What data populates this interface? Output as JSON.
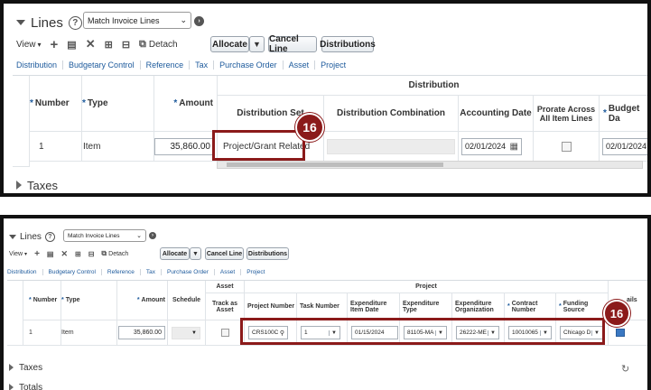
{
  "panel1": {
    "title": "Lines",
    "help": "?",
    "view_selector": "Match Invoice Lines",
    "toolbar": {
      "view": "View",
      "detach": "Detach",
      "allocate": "Allocate",
      "cancel_line": "Cancel Line",
      "distributions": "Distributions"
    },
    "links": [
      "Distribution",
      "Budgetary Control",
      "Reference",
      "Tax",
      "Purchase Order",
      "Asset",
      "Project"
    ],
    "table": {
      "group_header": "Distribution",
      "col_number": "Number",
      "col_type": "Type",
      "col_amount": "Amount",
      "col_distribution_set": "Distribution Set",
      "col_distribution_combination": "Distribution Combination",
      "col_accounting_date": "Accounting Date",
      "col_prorate": "Prorate Across All Item Lines",
      "col_budget_date": "Budget Da",
      "row": {
        "number": "1",
        "type": "Item",
        "amount": "35,860.00",
        "distribution_set": "Project/Grant Related",
        "accounting_date": "02/01/2024",
        "budget_date": "02/01/2024"
      }
    },
    "callout": "16",
    "taxes": "Taxes"
  },
  "panel2": {
    "title": "Lines",
    "help": "?",
    "view_selector": "Match Invoice Lines",
    "toolbar": {
      "view": "View",
      "detach": "Detach",
      "allocate": "Allocate",
      "cancel_line": "Cancel Line",
      "distributions": "Distributions"
    },
    "links": [
      "Distribution",
      "Budgetary Control",
      "Reference",
      "Tax",
      "Purchase Order",
      "Asset",
      "Project"
    ],
    "table": {
      "group_asset": "Asset",
      "group_project": "Project",
      "col_number": "Number",
      "col_type": "Type",
      "col_amount": "Amount",
      "col_schedule": "Schedule",
      "col_track_as_asset": "Track as Asset",
      "col_project_number": "Project Number",
      "col_task_number": "Task Number",
      "col_expenditure_item_date": "Expenditure Item Date",
      "col_expenditure_type": "Expenditure Type",
      "col_expenditure_org": "Expenditure Organization",
      "col_contract_number": "Contract Number",
      "col_funding_source": "Funding Source",
      "col_details_partial": "ails",
      "row": {
        "number": "1",
        "type": "Item",
        "amount": "35,860.00",
        "project_number": "CRS100C",
        "task_number": "1",
        "expenditure_item_date": "01/15/2024",
        "expenditure_type": "81105-MA",
        "expenditure_org": "26222-ME",
        "contract_number": "10010065",
        "funding_source": "Chicago D"
      }
    },
    "callout": "16",
    "taxes": "Taxes",
    "totals": "Totals"
  }
}
